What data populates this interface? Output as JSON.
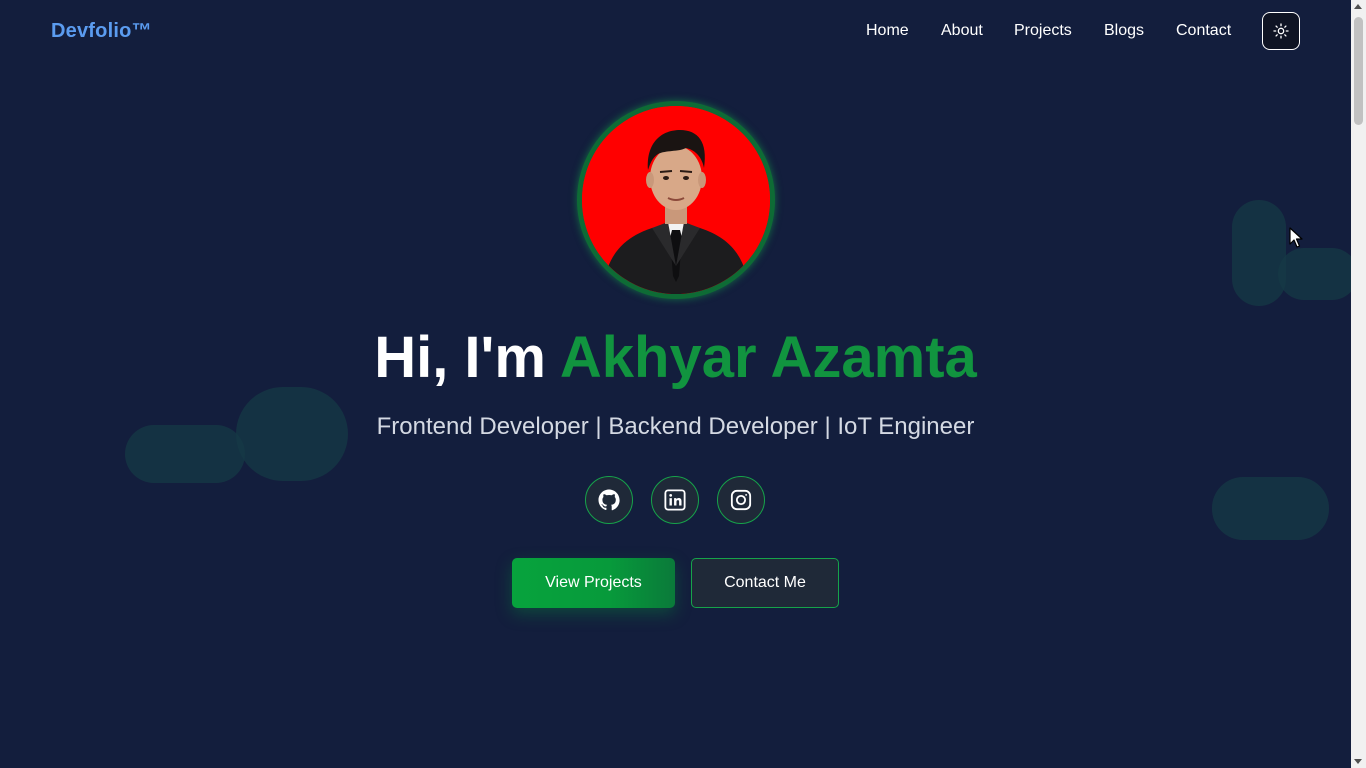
{
  "nav": {
    "brand": "Devfolio™",
    "links": [
      "Home",
      "About",
      "Projects",
      "Blogs",
      "Contact"
    ],
    "theme_toggle_icon": "sun-icon"
  },
  "hero": {
    "greeting": "Hi, I'm",
    "name": "Akhyar Azamta",
    "subtitle": "Frontend Developer | Backend Developer | IoT Engineer",
    "avatar_alt": "profile-photo",
    "social": [
      "github-icon",
      "linkedin-icon",
      "instagram-icon"
    ],
    "primary_button": "View Projects",
    "secondary_button": "Contact Me"
  },
  "colors": {
    "background": "#131e3d",
    "brand": "#5b9cf0",
    "accent_green": "#11943f",
    "avatar_bg": "#ff0000"
  }
}
